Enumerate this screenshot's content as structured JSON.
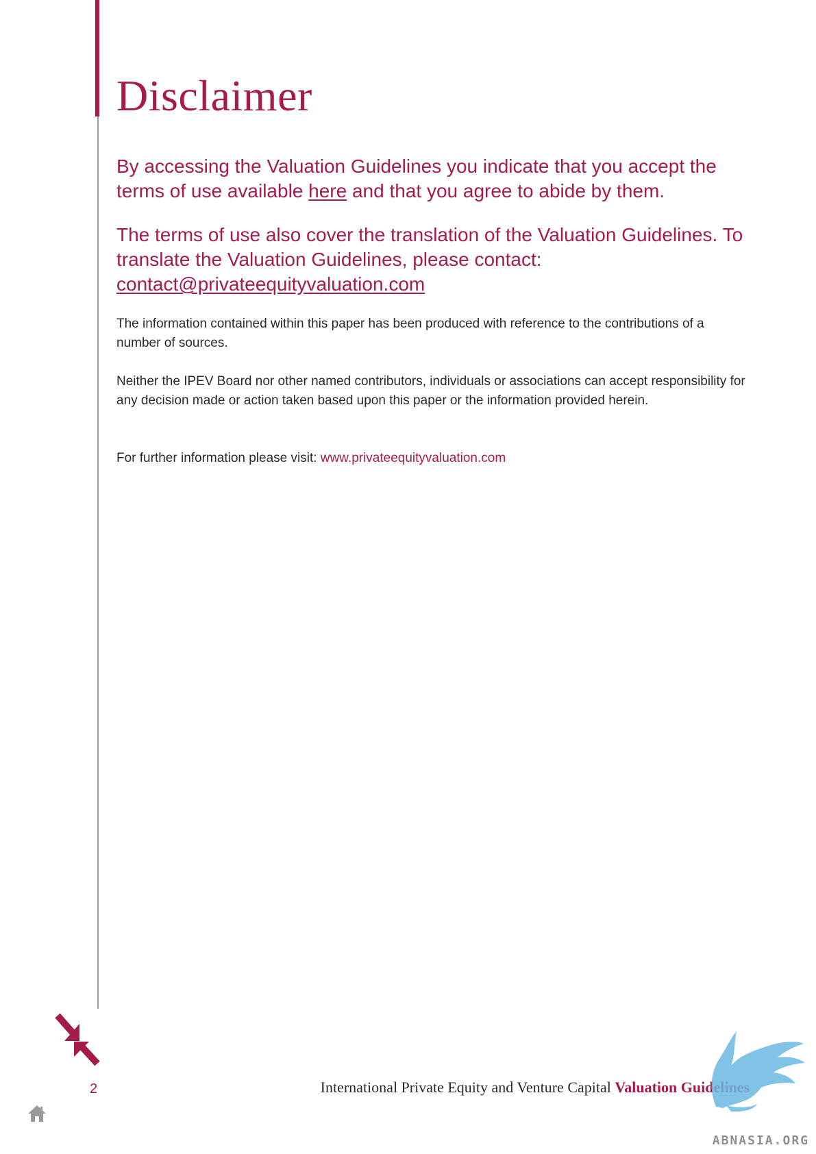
{
  "page": {
    "title": "Disclaimer",
    "lead_1": {
      "before": "By accessing the Valuation Guidelines you indicate that you accept the terms of use available ",
      "link": "here",
      "after": " and that you agree to abide by them."
    },
    "lead_2": {
      "text": "The terms of use also cover the translation of the Valuation Guidelines. To translate the Valuation Guidelines, please contact: ",
      "email": "contact@privateequityvaluation.com"
    },
    "paragraphs": [
      "The information contained within this paper has been produced with reference to the contributions of a number of sources.",
      "Neither the IPEV Board nor other named contributors, individuals or associations can accept responsibility for any decision made or action taken based upon this paper or the information provided herein."
    ],
    "further_info": {
      "label": "For further information please visit: ",
      "link": "www.privateequityvaluation.com"
    }
  },
  "footer": {
    "page_number": "2",
    "title_plain": "International Private Equity and Venture Capital ",
    "title_accent": "Valuation Guidelines",
    "watermark_text": "ABNASIA.ORG"
  },
  "icons": {
    "nav": "collapse-arrows-icon",
    "home": "home-icon",
    "watermark": "winged-griffin-logo-icon"
  },
  "colors": {
    "accent": "#a51c48",
    "body_text": "#2a2a2a",
    "rule": "#9a9a9a",
    "watermark": "#6bb9e3"
  }
}
